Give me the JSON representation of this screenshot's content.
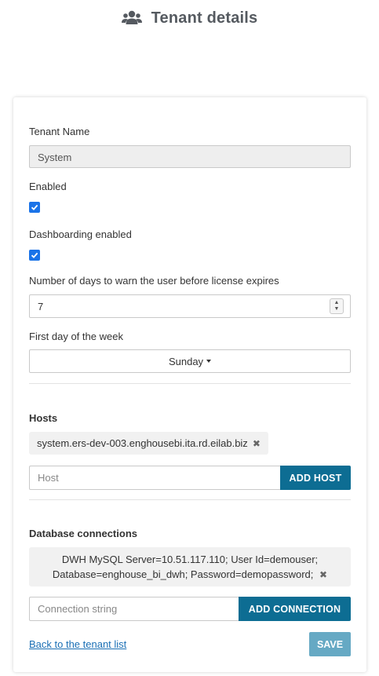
{
  "header": {
    "title": "Tenant details",
    "icon": "users-icon"
  },
  "form": {
    "tenant_name_label": "Tenant Name",
    "tenant_name_value": "System",
    "enabled_label": "Enabled",
    "enabled_checked": true,
    "dashboarding_label": "Dashboarding enabled",
    "dashboarding_checked": true,
    "warn_days_label": "Number of days to warn the user before license expires",
    "warn_days_value": "7",
    "first_day_label": "First day of the week",
    "first_day_value": "Sunday"
  },
  "hosts": {
    "heading": "Hosts",
    "items": [
      "system.ers-dev-003.enghousebi.ita.rd.eilab.biz"
    ],
    "input_placeholder": "Host",
    "add_label": "ADD HOST"
  },
  "db": {
    "heading": "Database connections",
    "items": [
      {
        "line1": "DWH MySQL Server=10.51.117.110; User Id=demouser;",
        "line2": "Database=enghouse_bi_dwh; Password=demopassword;"
      }
    ],
    "input_placeholder": "Connection string",
    "add_label": "ADD CONNECTION"
  },
  "footer": {
    "back_link": "Back to the tenant list",
    "save_label": "SAVE"
  },
  "colors": {
    "primary": "#0d6d93",
    "save_disabled": "#66a9c4",
    "checkbox": "#1a73e8",
    "link": "#1a6fb5"
  }
}
